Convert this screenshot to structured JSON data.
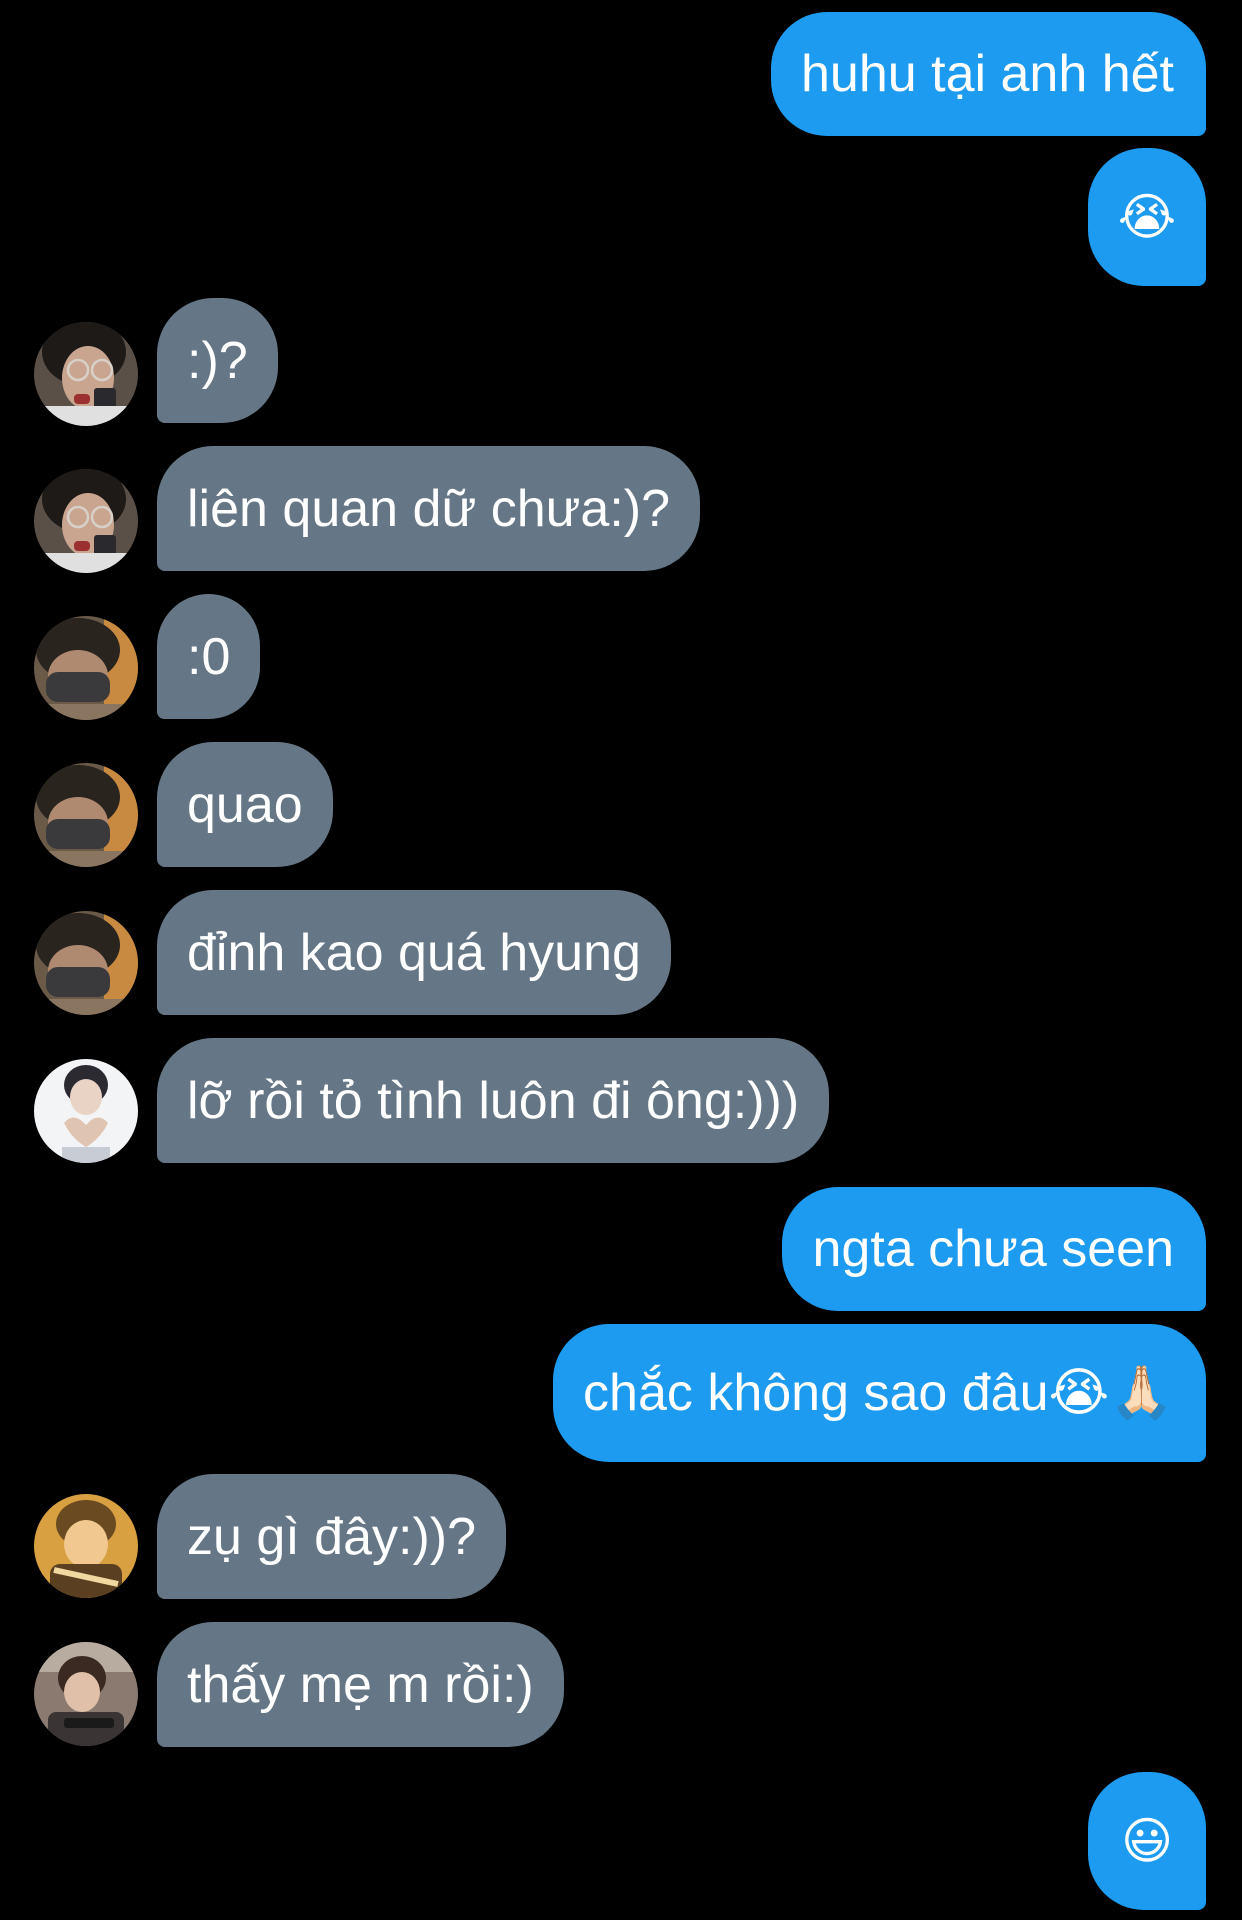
{
  "conversation": {
    "messages": [
      {
        "side": "out",
        "text": "huhu tại anh hết"
      },
      {
        "side": "out",
        "text": "😭"
      },
      {
        "side": "in",
        "text": ":)?",
        "avatar": "avatar-glasses"
      },
      {
        "side": "in",
        "text": "liên quan dữ chưa:)?",
        "avatar": "avatar-glasses"
      },
      {
        "side": "in",
        "text": ":0",
        "avatar": "avatar-masked"
      },
      {
        "side": "in",
        "text": "quao",
        "avatar": "avatar-masked"
      },
      {
        "side": "in",
        "text": "đỉnh kao quá hyung",
        "avatar": "avatar-masked"
      },
      {
        "side": "in",
        "text": "lỡ rồi tỏ tình luôn đi ông:)))",
        "avatar": "avatar-heart-hands"
      },
      {
        "side": "out",
        "text": "ngta chưa seen"
      },
      {
        "side": "out",
        "text": "chắc không sao đâu😭🙏🏻"
      },
      {
        "side": "in",
        "text": "zụ gì đây:))?",
        "avatar": "avatar-warm"
      },
      {
        "side": "in",
        "text": "thấy mẹ m rồi:)",
        "avatar": "avatar-guitar"
      },
      {
        "side": "out",
        "text": "😃"
      }
    ]
  },
  "colors": {
    "outgoing_bubble": "#1d9bf0",
    "incoming_bubble": "#657786",
    "background": "#000000",
    "text": "#ffffff"
  }
}
